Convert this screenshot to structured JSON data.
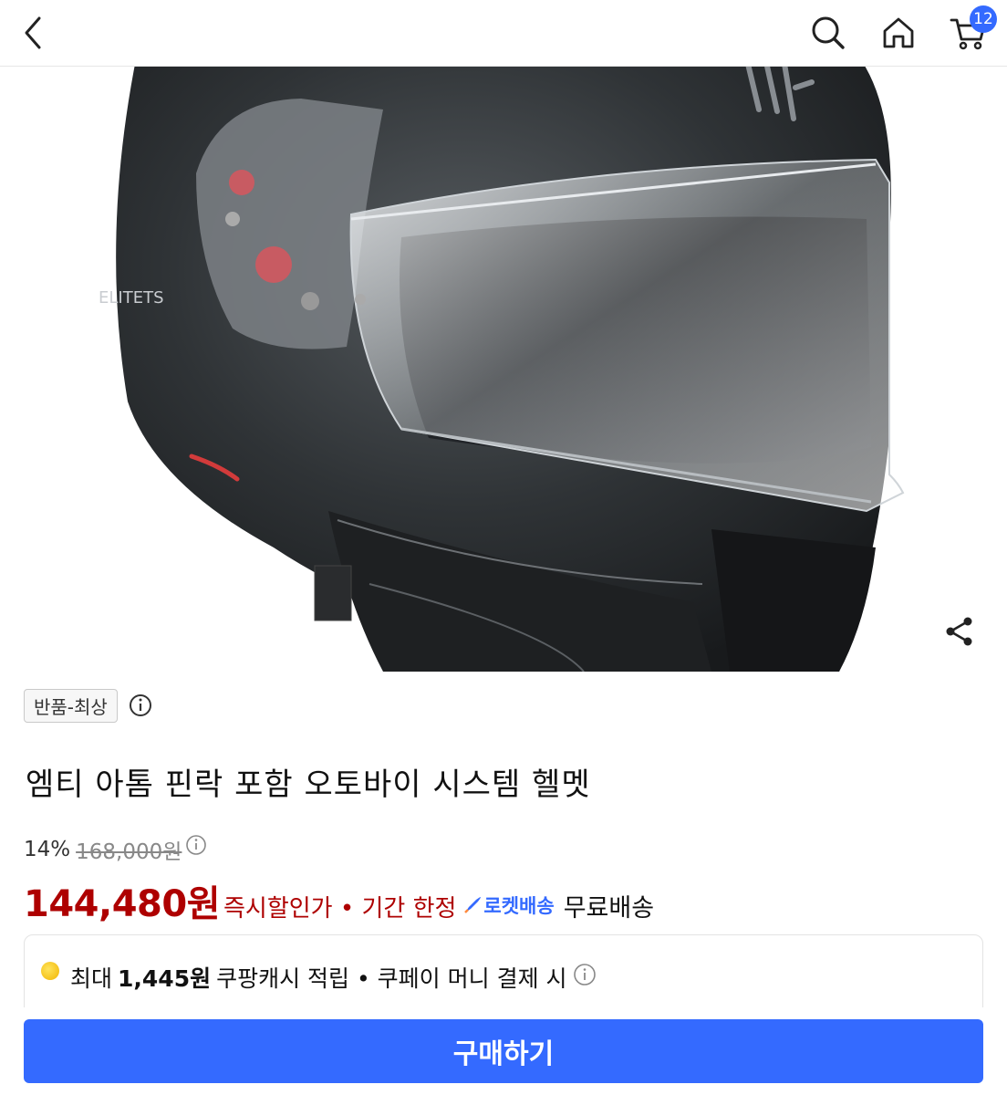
{
  "header": {
    "cart_count": "12"
  },
  "product": {
    "condition_tag": "반품-최상",
    "title": "엠티 아톰 핀락 포함 오토바이 시스템 헬멧",
    "discount_rate": "14%",
    "original_price": "168,000원",
    "price": "144,480원",
    "instant_discount_text": "즉시할인가 • 기간 한정",
    "rocket_label": "로켓배송",
    "shipping_text": "무료배송",
    "helmet_brand_text": "ELITETS"
  },
  "cash_reward": {
    "prefix": "최대",
    "amount": "1,445원",
    "suffix": "쿠팡캐시 적립 • 쿠페이 머니 결제 시"
  },
  "buy_button": {
    "label": "구매하기"
  },
  "colors": {
    "accent_blue": "#346aff",
    "price_red": "#ae0000"
  }
}
